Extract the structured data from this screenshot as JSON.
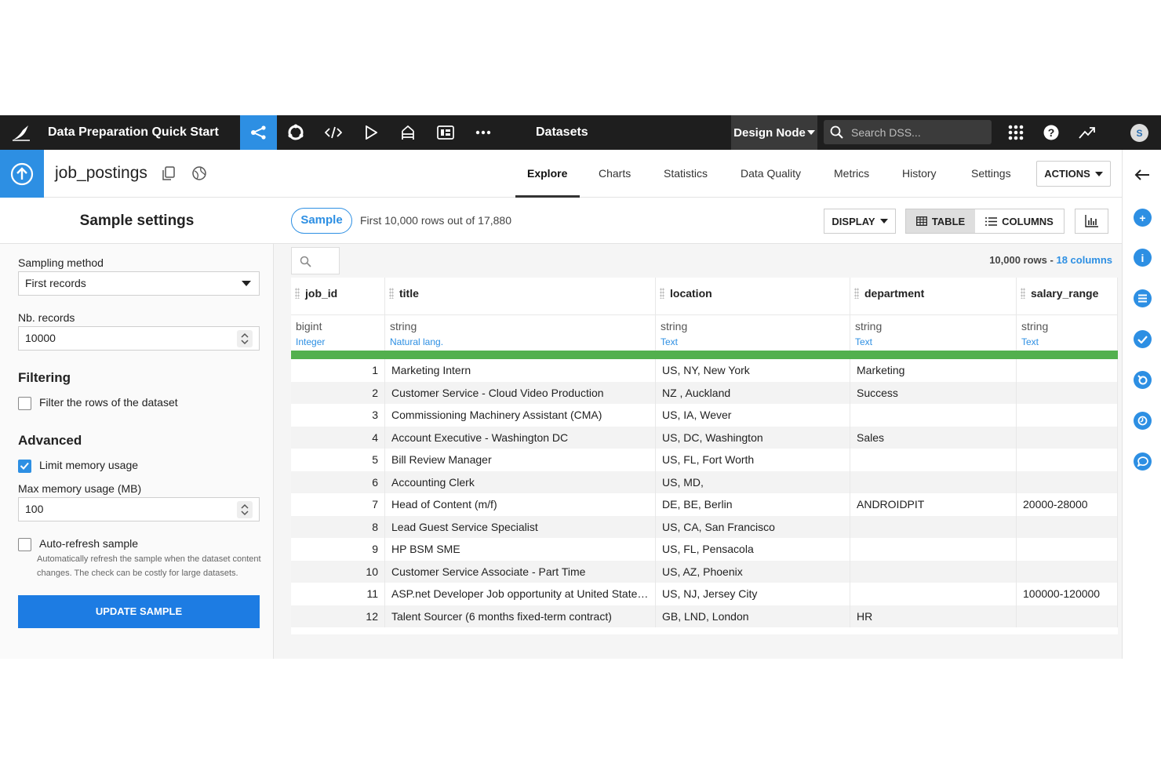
{
  "topbar": {
    "project_title": "Data Preparation Quick Start",
    "section": "Datasets",
    "node_selector": "Design Node",
    "search_placeholder": "Search DSS...",
    "avatar_initial": "S"
  },
  "dataset": {
    "name": "job_postings",
    "tabs": [
      "Explore",
      "Charts",
      "Statistics",
      "Data Quality",
      "Metrics",
      "History",
      "Settings"
    ],
    "active_tab": "Explore",
    "actions_label": "ACTIONS"
  },
  "sample_settings": {
    "title": "Sample settings",
    "sampling_method_label": "Sampling method",
    "sampling_method_value": "First records",
    "nb_records_label": "Nb. records",
    "nb_records_value": "10000",
    "filtering_title": "Filtering",
    "filter_rows_label": "Filter the rows of the dataset",
    "filter_rows_checked": false,
    "advanced_title": "Advanced",
    "limit_memory_label": "Limit memory usage",
    "limit_memory_checked": true,
    "max_memory_label": "Max memory usage (MB)",
    "max_memory_value": "100",
    "auto_refresh_label": "Auto-refresh sample",
    "auto_refresh_checked": false,
    "auto_refresh_help": "Automatically refresh the sample when the dataset content changes. The check can be costly for large datasets.",
    "update_button": "UPDATE SAMPLE"
  },
  "toolbar": {
    "sample_pill": "Sample",
    "sample_info": "First 10,000 rows out of 17,880",
    "display_label": "DISPLAY",
    "table_label": "TABLE",
    "columns_label": "COLUMNS",
    "rows_summary": "10,000 rows - ",
    "columns_summary": "18 columns"
  },
  "table": {
    "columns": [
      {
        "name": "job_id",
        "storage": "bigint",
        "meaning": "Integer"
      },
      {
        "name": "title",
        "storage": "string",
        "meaning": "Natural lang."
      },
      {
        "name": "location",
        "storage": "string",
        "meaning": "Text"
      },
      {
        "name": "department",
        "storage": "string",
        "meaning": "Text"
      },
      {
        "name": "salary_range",
        "storage": "string",
        "meaning": "Text"
      }
    ],
    "rows": [
      [
        "1",
        "Marketing Intern",
        "US, NY, New York",
        "Marketing",
        ""
      ],
      [
        "2",
        "Customer Service - Cloud Video Production",
        "NZ , Auckland",
        "Success",
        ""
      ],
      [
        "3",
        "Commissioning Machinery Assistant (CMA)",
        "US, IA, Wever",
        "",
        ""
      ],
      [
        "4",
        "Account Executive - Washington DC",
        "US, DC, Washington",
        "Sales",
        ""
      ],
      [
        "5",
        "Bill Review Manager",
        "US, FL, Fort Worth",
        "",
        ""
      ],
      [
        "6",
        "Accounting Clerk",
        "US, MD,",
        "",
        ""
      ],
      [
        "7",
        "Head of Content (m/f)",
        "DE, BE, Berlin",
        "ANDROIDPIT",
        "20000-28000"
      ],
      [
        "8",
        "Lead Guest Service Specialist",
        "US, CA, San Francisco",
        "",
        ""
      ],
      [
        "9",
        "HP BSM SME",
        "US, FL, Pensacola",
        "",
        ""
      ],
      [
        "10",
        "Customer Service Associate - Part Time",
        "US, AZ, Phoenix",
        "",
        ""
      ],
      [
        "11",
        "ASP.net Developer Job opportunity at United States, New Jersey",
        "US, NJ, Jersey City",
        "",
        "100000-120000"
      ],
      [
        "12",
        "Talent Sourcer (6 months fixed-term contract)",
        "GB, LND, London",
        "HR",
        ""
      ]
    ]
  },
  "colors": {
    "accent": "#2d8fe3",
    "topbar": "#1e1e1e",
    "valid_bar": "#52b04e",
    "button_blue": "#1d7ce3"
  },
  "icons": {
    "topbar": [
      "flow-icon",
      "recipes-icon",
      "code-icon",
      "run-icon",
      "deploy-icon",
      "dashboard-icon",
      "more-icon"
    ],
    "rail": [
      "back-arrow-icon",
      "add-icon",
      "info-icon",
      "schema-icon",
      "check-icon",
      "lab-icon",
      "timeline-icon",
      "discussion-icon"
    ]
  }
}
